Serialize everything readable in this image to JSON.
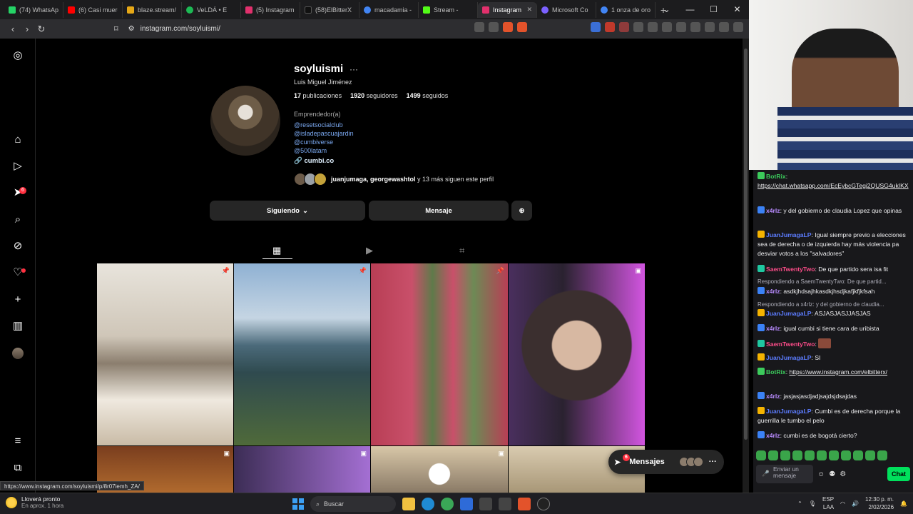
{
  "browser": {
    "tabs": [
      {
        "label": "(74) WhatsApp",
        "color": "#25d366",
        "icon": "whatsapp-icon"
      },
      {
        "label": "(6) Casi muere",
        "color": "#ff0000",
        "icon": "youtube-icon"
      },
      {
        "label": "blaze.stream/",
        "color": "#e6a817",
        "icon": "blaze-icon"
      },
      {
        "label": "VeLDÁ • E",
        "color": "#1db954",
        "icon": "spotify-icon"
      },
      {
        "label": "(5) Instagram",
        "color": "#e1306c",
        "icon": "instagram-icon"
      },
      {
        "label": "(58)ElBitterX",
        "color": "#111111",
        "icon": "tiktok-icon"
      },
      {
        "label": "macadamia -",
        "color": "#4285f4",
        "icon": "google-icon"
      },
      {
        "label": "Stream -",
        "color": "#53fc18",
        "icon": "kick-icon"
      },
      {
        "label": "Instagram",
        "color": "#e1306c",
        "icon": "instagram-icon",
        "active": true
      },
      {
        "label": "Microsoft Co",
        "color": "#7b61ff",
        "icon": "copilot-icon"
      },
      {
        "label": "1 onza de oro",
        "color": "#4285f4",
        "icon": "google-icon"
      }
    ],
    "url": "instagram.com/soyluismi/",
    "status_url": "https://www.instagram.com/soyluismi/p/8r07iemh_ZA/",
    "ext_badge": "6"
  },
  "profile": {
    "username": "soyluismi",
    "full_name": "Luis Miguel Jiménez",
    "posts_count": "17",
    "posts_label": "publicaciones",
    "followers_count": "1920",
    "followers_label": "seguidores",
    "following_count": "1499",
    "following_label": "seguidos",
    "category": "Emprendedor(a)",
    "bio_links": [
      "@resetsocialclub",
      "@isladepascuajardin",
      "@cumbiverse",
      "@500latam"
    ],
    "website": "cumbi.co",
    "mutual_names": "juanjumaga, georgewashtol",
    "mutual_rest": "y 13 más siguen este perfil",
    "following_button": "Siguiendo",
    "message_button": "Mensaje"
  },
  "sidebar": {
    "notifications_badge": "6"
  },
  "messages_bar": {
    "label": "Mensajes",
    "badge": "6"
  },
  "taskbar": {
    "weather_title": "Lloverá pronto",
    "weather_sub": "En aprox. 1 hora",
    "search_placeholder": "Buscar",
    "lang": "ESP",
    "lang_sub": "LAA",
    "time": "12:30 p. m.",
    "date": "2/02/2026"
  },
  "chat": {
    "messages": [
      {
        "user": "BotRix",
        "color": "#3ccb5c",
        "text": "https://chat.whatsapp.com/EcEybcGTegj2QUSG4ukIKX",
        "link": true
      },
      {
        "user": "x4rlz",
        "color": "#b98bff",
        "text": "y del gobierno de claudia Lopez que opinas"
      },
      {
        "user": "JuanJumagaLP",
        "color": "#5c7cff",
        "text": "Igual siempre previo a elecciones sea de derecha o de izquierda hay más violencia pa desviar votos a los \"salvadores\""
      },
      {
        "user": "SaemTwentyTwo",
        "color": "#ff4d8a",
        "text": "De que partido sera isa fit"
      },
      {
        "user": "x4rlz",
        "color": "#b98bff",
        "text": "asdkjhdsajhkasdkjhsdjkafjkfjkfsah",
        "reply": "Respondiendo a SaemTwentyTwo: De que partid..."
      },
      {
        "user": "JuanJumagaLP",
        "color": "#5c7cff",
        "text": "ASJASJASJJASJAS",
        "reply": "Respondiendo a x4rlz: y del gobierno de claudia..."
      },
      {
        "user": "x4rlz",
        "color": "#b98bff",
        "text": "igual cumbi si tiene cara de uribista"
      },
      {
        "user": "SaemTwentyTwo",
        "color": "#ff4d8a",
        "text": ""
      },
      {
        "user": "JuanJumagaLP",
        "color": "#5c7cff",
        "text": "SI"
      },
      {
        "user": "BotRix",
        "color": "#3ccb5c",
        "text": "https://www.instagram.com/elbitterx/",
        "link": true
      },
      {
        "user": "x4rlz",
        "color": "#b98bff",
        "text": "jasjasjasdjadjsajdsjdsajdas"
      },
      {
        "user": "JuanJumagaLP",
        "color": "#5c7cff",
        "text": "Cumbi es de derecha porque la guerrilla le tumbo el pelo"
      },
      {
        "user": "x4rlz",
        "color": "#b98bff",
        "text": "cumbi es de bogotá cierto?"
      }
    ],
    "input_placeholder": "Enviar un mensaje",
    "chat_button": "Chat"
  }
}
